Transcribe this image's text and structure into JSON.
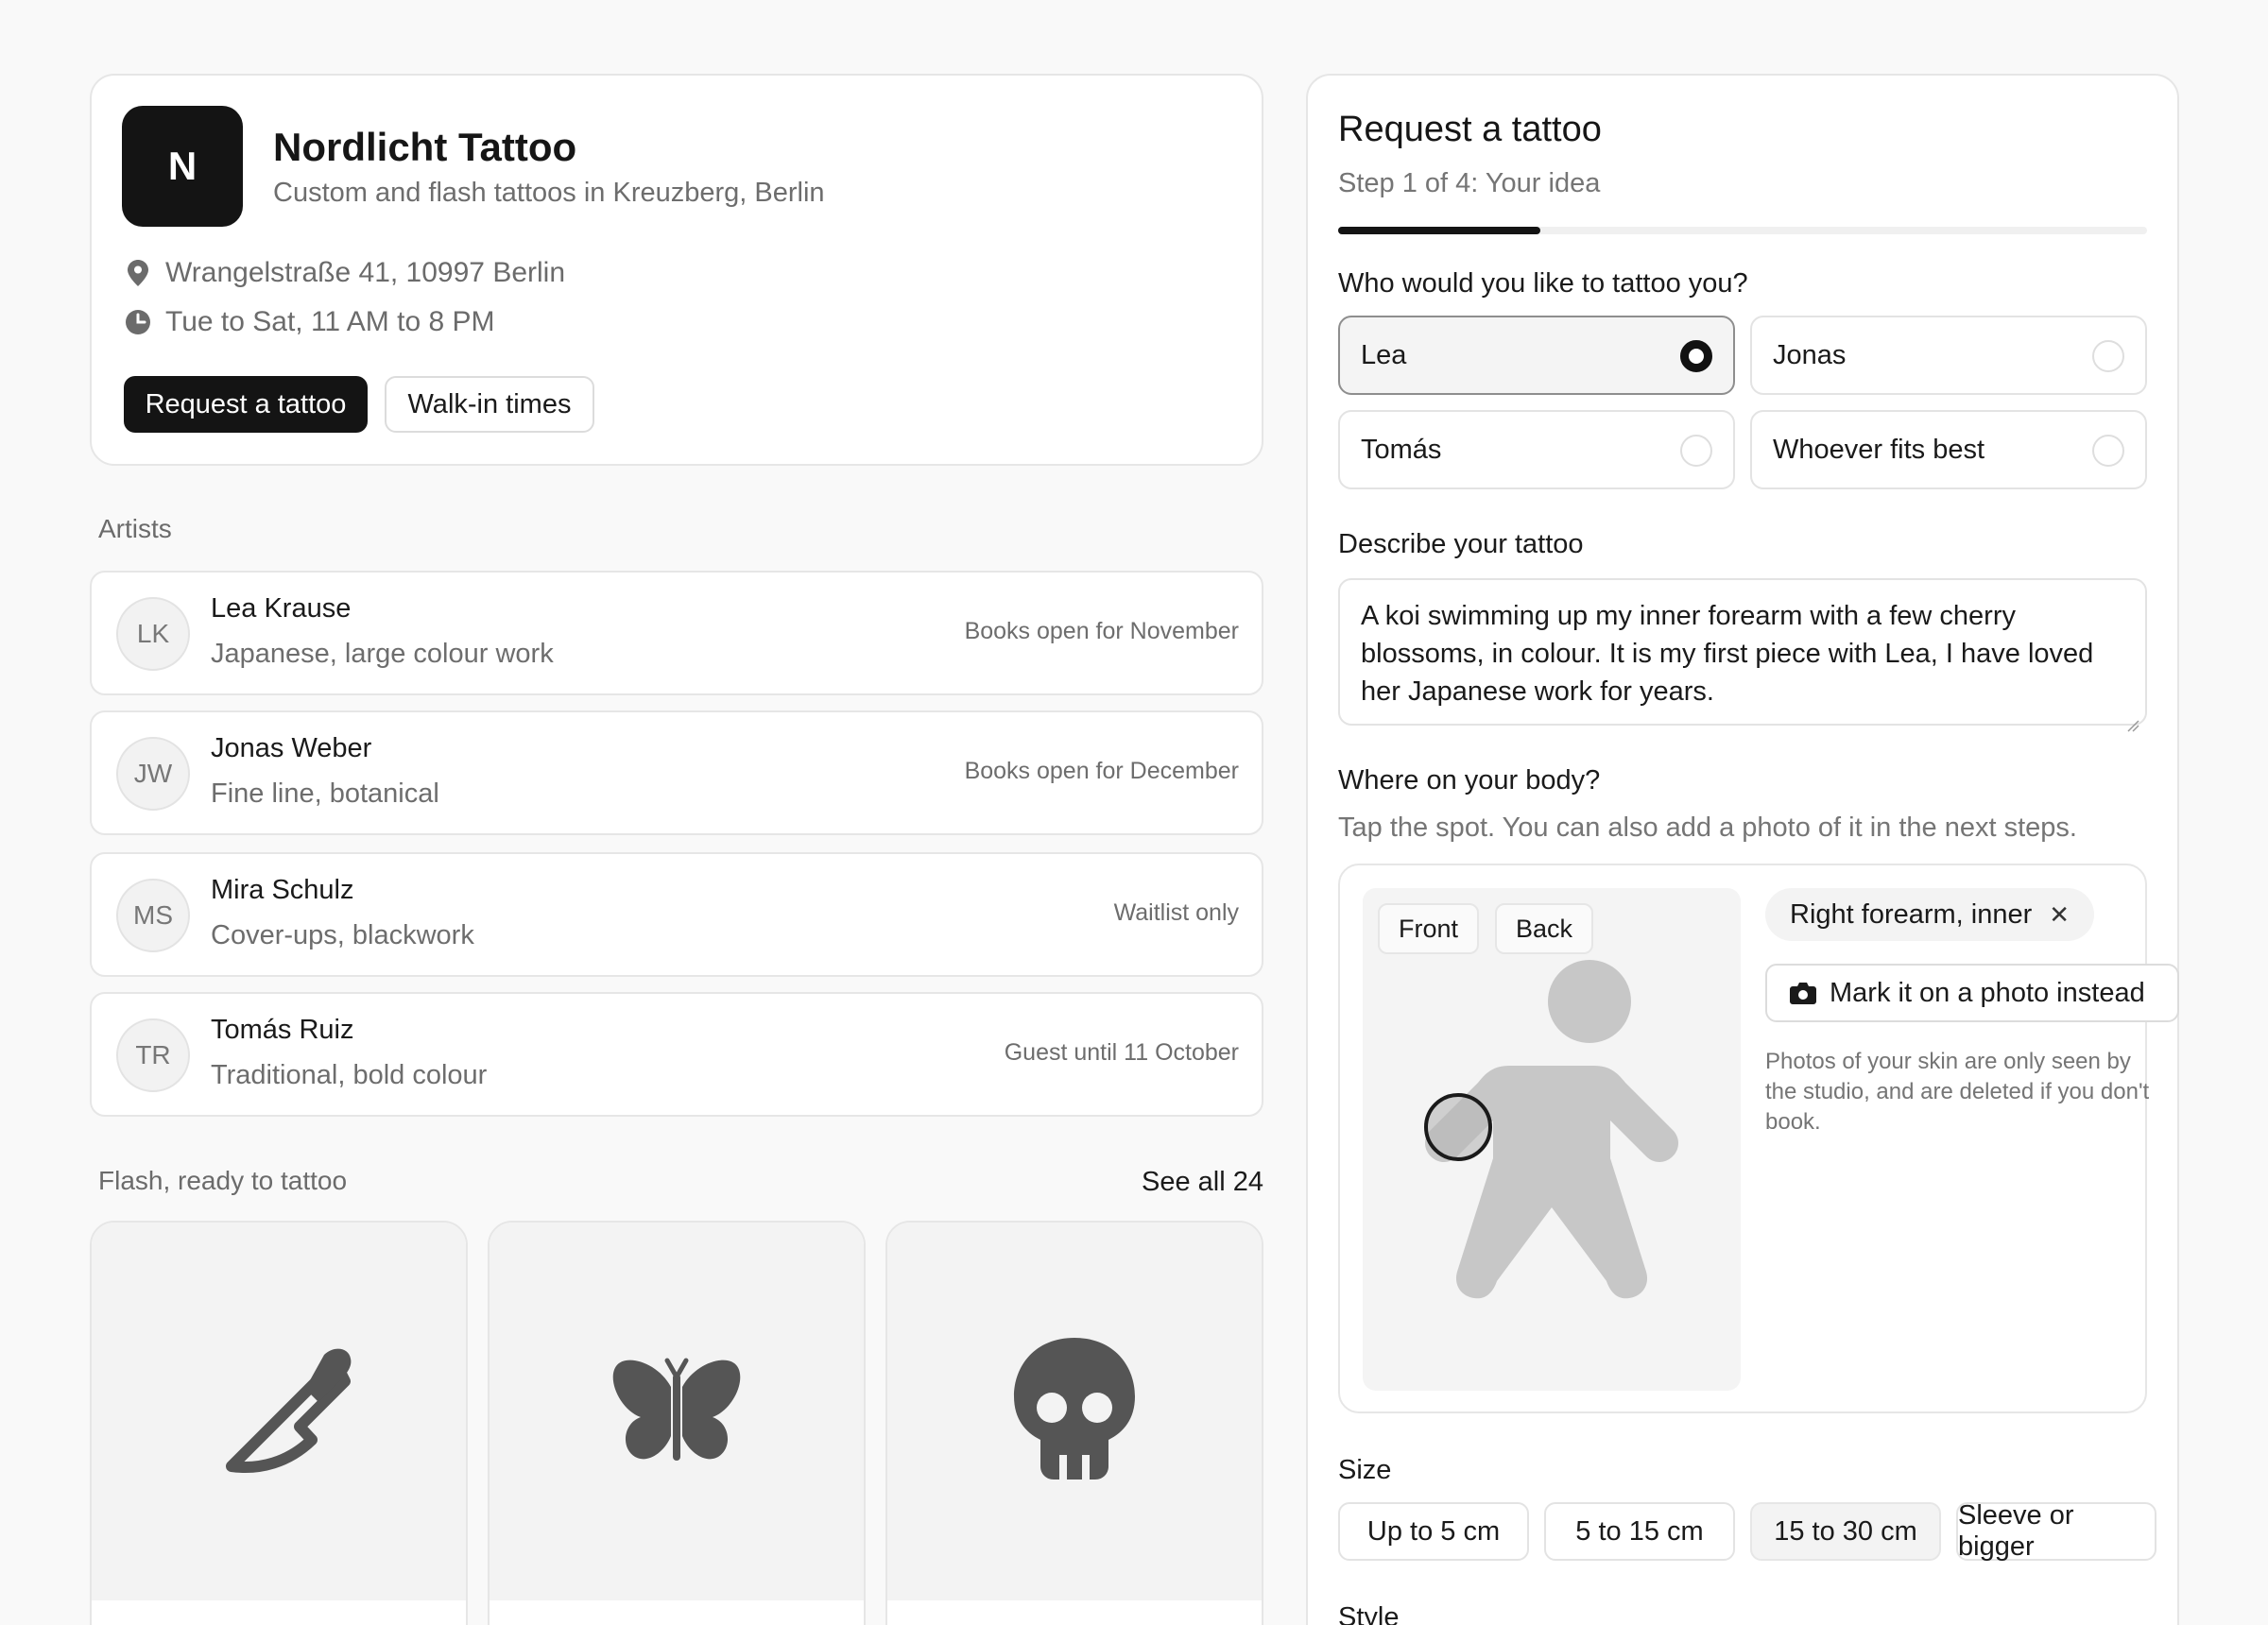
{
  "studio": {
    "logo_letter": "N",
    "name": "Nordlicht Tattoo",
    "tagline": "Custom and flash tattoos in Kreuzberg, Berlin",
    "address": "Wrangelstraße 41, 10997 Berlin",
    "hours": "Tue to Sat, 11 AM to 8 PM",
    "primary_button": "Request a tattoo",
    "secondary_button": "Walk-in times"
  },
  "artists": {
    "heading": "Artists",
    "items": [
      {
        "initials": "LK",
        "name": "Lea Krause",
        "style": "Japanese, large colour work",
        "status": "Books open for November"
      },
      {
        "initials": "JW",
        "name": "Jonas Weber",
        "style": "Fine line, botanical",
        "status": "Books open for December"
      },
      {
        "initials": "MS",
        "name": "Mira Schulz",
        "style": "Cover-ups, blackwork",
        "status": "Waitlist only"
      },
      {
        "initials": "TR",
        "name": "Tomás Ruiz",
        "style": "Traditional, bold colour",
        "status": "Guest until 11 October"
      }
    ]
  },
  "flash": {
    "heading": "Flash, ready to tattoo",
    "see_all": "See all 24",
    "items": [
      {
        "icon": "dagger-icon"
      },
      {
        "icon": "butterfly-icon"
      },
      {
        "icon": "skull-icon"
      }
    ]
  },
  "request": {
    "title": "Request a tattoo",
    "step": "Step 1 of 4: Your idea",
    "progress": 0.25,
    "artist_question": "Who would you like to tattoo you?",
    "artist_options": [
      "Lea",
      "Jonas",
      "Tomás",
      "Whoever fits best"
    ],
    "selected_artist": "Lea",
    "describe_label": "Describe your tattoo",
    "description": "A koi swimming up my inner forearm with a few cherry blossoms, in colour. It is my first piece with Lea, I have loved her Japanese work for years.",
    "placement_label": "Where on your body?",
    "placement_hint": "Tap the spot. You can also add a photo of it in the next steps.",
    "view_tabs": [
      "Front",
      "Back"
    ],
    "selected_spot": "Right forearm, inner",
    "photo_button": "Mark it on a photo instead",
    "privacy_note": "Photos of your skin are only seen by the studio, and are deleted if you don't book.",
    "size_label": "Size",
    "size_options": [
      "Up to 5 cm",
      "5 to 15 cm",
      "15 to 30 cm",
      "Sleeve or bigger"
    ],
    "selected_size": "15 to 30 cm",
    "style_label": "Style"
  },
  "colors": {
    "accent": "#141414",
    "background": "#f9f9f9",
    "card": "#ffffff",
    "muted_text": "#6d6d6d",
    "icon_fill": "#555555"
  }
}
